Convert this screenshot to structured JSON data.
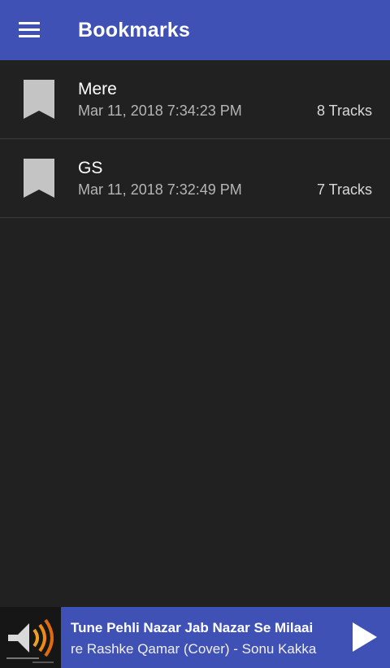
{
  "appbar": {
    "title": "Bookmarks",
    "menu_icon": "hamburger-menu-icon",
    "color": "#3f51b5"
  },
  "bookmarks": [
    {
      "name": "Mere",
      "date": "Mar 11, 2018 7:34:23 PM",
      "tracks": "8 Tracks",
      "icon": "bookmark-icon"
    },
    {
      "name": "GS",
      "date": "Mar 11, 2018 7:32:49 PM",
      "tracks": "7 Tracks",
      "icon": "bookmark-icon"
    }
  ],
  "player": {
    "line1": "Tune Pehli Nazar Jab Nazar Se Milaai",
    "line2": "re Rashke Qamar (Cover) - Sonu Kakka",
    "play_icon": "play-icon",
    "album_icon": "speaker-icon"
  }
}
